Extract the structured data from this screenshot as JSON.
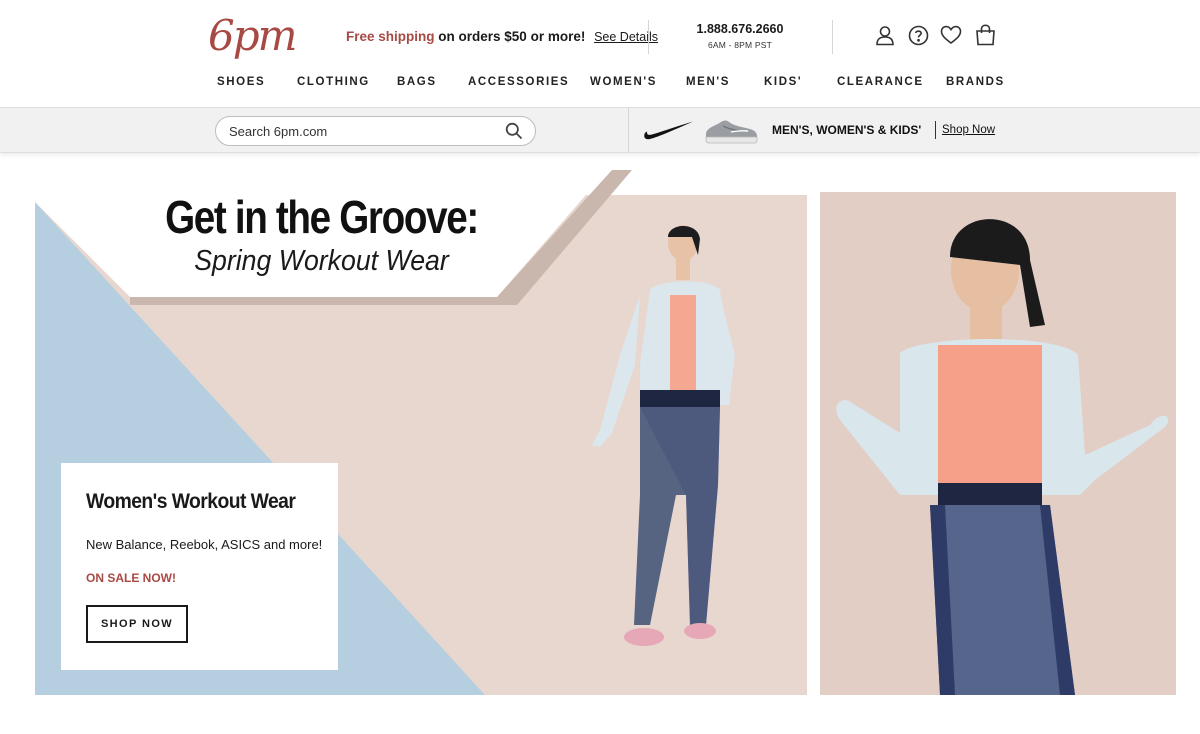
{
  "brand": {
    "logo_text": "6pm",
    "logo_color": "#a84a44"
  },
  "promo": {
    "highlight": "Free shipping",
    "rest": "on orders $50 or more!",
    "link": "See Details"
  },
  "contact": {
    "phone": "1.888.676.2660",
    "hours": "6AM - 8PM PST"
  },
  "header_icons": [
    {
      "name": "account-icon",
      "label": "Account"
    },
    {
      "name": "help-icon",
      "label": "Help"
    },
    {
      "name": "favorites-heart-icon",
      "label": "Favorites"
    },
    {
      "name": "shopping-bag-icon",
      "label": "Cart"
    }
  ],
  "nav": {
    "items": [
      "SHOES",
      "CLOTHING",
      "BAGS",
      "ACCESSORIES",
      "WOMEN'S",
      "MEN'S",
      "KIDS'",
      "CLEARANCE",
      "BRANDS"
    ]
  },
  "search": {
    "placeholder": "Search 6pm.com"
  },
  "nike_banner": {
    "text": "MEN'S, WOMEN'S & KIDS'",
    "link": "Shop Now"
  },
  "hero": {
    "headline": "Get in the Groove:",
    "subheadline": "Spring Workout Wear",
    "colors": {
      "blue": "#b6cfe0",
      "blush": "#e8d7cf",
      "taupe": "#c9b7ad"
    }
  },
  "card": {
    "title": "Women's Workout Wear",
    "subtitle": "New Balance, Reebok, ASICS and more!",
    "sale": "ON SALE NOW!",
    "button": "SHOP NOW"
  }
}
